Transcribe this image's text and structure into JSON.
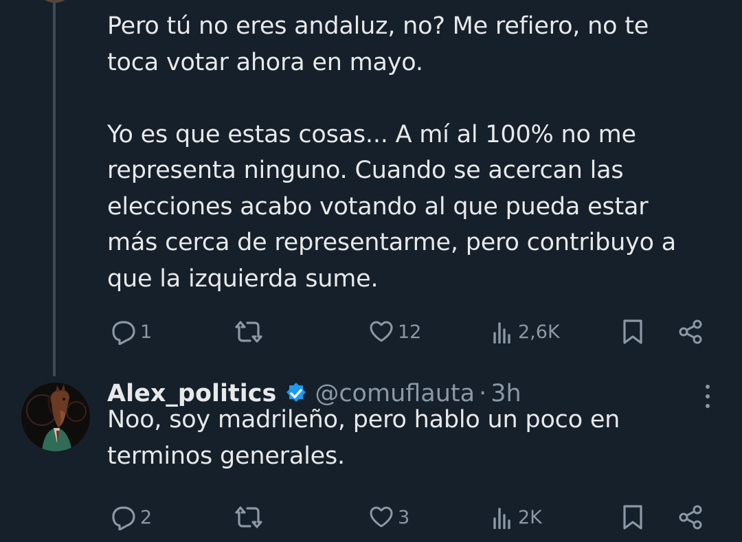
{
  "tweet1": {
    "text": "Pero tú no eres andaluz, no? Me refiero, no te\ntoca votar ahora en mayo.\n\nYo es que estas cosas... A mí al 100% no me\nrepresenta ninguno. Cuando se acercan las\nelecciones acabo votando al que pueda estar\nmás cerca de representarme, pero contribuyo a\nque la izquierda sume.",
    "replies": "1",
    "retweets": "",
    "likes": "12",
    "views": "2,6K"
  },
  "tweet2": {
    "display_name": "Alex_politics",
    "handle": "@comuflauta",
    "separator": "·",
    "time": "3h",
    "text": "Noo, soy madrileño, pero hablo un poco en\nterminos generales.",
    "replies": "2",
    "retweets": "",
    "likes": "3",
    "views": "2K"
  },
  "icons": {
    "reply": "reply-icon",
    "retweet": "retweet-icon",
    "like": "heart-icon",
    "views": "views-icon",
    "bookmark": "bookmark-icon",
    "share": "share-icon",
    "verified": "verified-badge-icon",
    "more": "more-icon"
  },
  "colors": {
    "background": "#16202a",
    "text": "#e7e9ea",
    "muted": "#8b98a5",
    "verified": "#1d9bf0"
  }
}
